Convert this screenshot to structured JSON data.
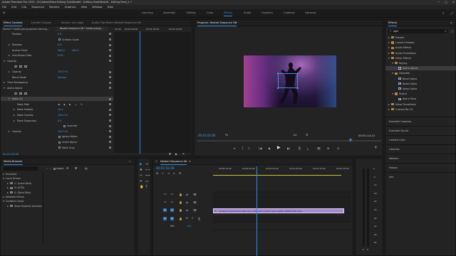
{
  "app": {
    "title": "Adobe Premiere Pro 2022 - D:\\Video\\Video Editing Tuts\\Reddit - Editing Feed\\Reddit - Editing Feed_1 *",
    "window_controls": [
      "−",
      "□",
      "✕"
    ]
  },
  "menu": [
    "File",
    "Edit",
    "Clip",
    "Sequence",
    "Markers",
    "Graphics",
    "View",
    "Window",
    "Help"
  ],
  "workspaces": {
    "items": [
      "Learning",
      "Assembly",
      "Editing",
      "Color",
      "Effects",
      "Audio",
      "Graphics",
      "Captions",
      "Libraries"
    ],
    "active": "Effects"
  },
  "effect_controls": {
    "tabs": [
      "Effect Controls",
      "Lumetri Scopes",
      "Source: (no clips)",
      "Audio Clip Mixer: Nested Sequence 06"
    ],
    "source_label": "Source * model-young-woman-dancing...",
    "sequence_label": "Nested Sequence 06 * model-young...",
    "ruler_times": [
      "00:00",
      "00:01:00:00",
      "00:01:05:00",
      "00:01:10:00"
    ],
    "properties": [
      {
        "name": "Position",
        "v1": "0.0",
        "v2": "",
        "indent": 1,
        "expander": "none"
      },
      {
        "name": "Uniform Scale",
        "v1": "",
        "v2": "",
        "indent": 1,
        "expander": "checkbox"
      },
      {
        "name": "Rotation",
        "v1": "0.0",
        "v2": "",
        "indent": 1,
        "expander": "right"
      },
      {
        "name": "Anchor Point",
        "v1": "960.0",
        "v2": "540.0",
        "indent": 1,
        "expander": "none"
      },
      {
        "name": "Anti-flicker Filter",
        "v1": "0.00",
        "v2": "",
        "indent": 1,
        "expander": "right"
      },
      {
        "name": "Opacity",
        "v1": "",
        "v2": "",
        "indent": 0,
        "expander": "down"
      },
      {
        "name": "",
        "v1": "",
        "v2": "",
        "indent": 1,
        "expander": "masks"
      },
      {
        "name": "Opacity",
        "v1": "100.0 %",
        "v2": "",
        "indent": 1,
        "expander": "right"
      },
      {
        "name": "Blend Mode",
        "v1": "Normal",
        "v2": "",
        "indent": 1,
        "expander": "none"
      },
      {
        "name": "Time Remapping",
        "v1": "",
        "v2": "",
        "indent": 0,
        "expander": "right"
      },
      {
        "name": "Alpha Adjust",
        "v1": "",
        "v2": "",
        "indent": 0,
        "expander": "down"
      },
      {
        "name": "",
        "v1": "",
        "v2": "",
        "indent": 1,
        "expander": "masks"
      },
      {
        "name": "Mask (1)",
        "v1": "",
        "v2": "",
        "indent": 1,
        "expander": "down",
        "selected": true
      },
      {
        "name": "Mask Path",
        "v1": "",
        "v2": "",
        "indent": 2,
        "expander": "none"
      },
      {
        "name": "Mask Feather",
        "v1": "10.0",
        "v2": "",
        "indent": 2,
        "expander": "right"
      },
      {
        "name": "Mask Opacity",
        "v1": "100.0 %",
        "v2": "",
        "indent": 2,
        "expander": "right"
      },
      {
        "name": "Mask Expansion",
        "v1": "0.0",
        "v2": "",
        "indent": 2,
        "expander": "right"
      },
      {
        "name": "Inverted",
        "v1": "",
        "v2": "",
        "indent": 2,
        "expander": "checkbox"
      },
      {
        "name": "Opacity",
        "v1": "100.0 %",
        "v2": "",
        "indent": 1,
        "expander": "right"
      },
      {
        "name": "Ignore Alpha",
        "v1": "",
        "v2": "",
        "indent": 1,
        "expander": "checkbox"
      },
      {
        "name": "Invert Alpha",
        "v1": "",
        "v2": "",
        "indent": 1,
        "expander": "checkbox"
      },
      {
        "name": "Mask Only",
        "v1": "",
        "v2": "",
        "indent": 1,
        "expander": "checkbox"
      }
    ],
    "timecode": "00:01:02:06"
  },
  "program": {
    "tab": "Program: Nested Sequence 06",
    "timecode": "00:01:02:06",
    "fit": "Fit",
    "quality": "1/4",
    "duration": "00:01:14:13",
    "controls": [
      "▾",
      "{",
      "}",
      "|◀",
      "◀",
      "▶",
      "▶|",
      "⎘",
      "⤓",
      "📷",
      "⊞",
      "⊡",
      "+"
    ]
  },
  "effects_panel": {
    "tab": "Effects",
    "search_value": "alph",
    "tree": [
      {
        "label": "Presets",
        "indent": 0,
        "exp": "right",
        "kind": "folder"
      },
      {
        "label": "Lumetri Presets",
        "indent": 0,
        "exp": "right",
        "kind": "folder"
      },
      {
        "label": "Audio Effects",
        "indent": 0,
        "exp": "right",
        "kind": "folder"
      },
      {
        "label": "Audio Transitions",
        "indent": 0,
        "exp": "right",
        "kind": "folder"
      },
      {
        "label": "Video Effects",
        "indent": 0,
        "exp": "down",
        "kind": "folder"
      },
      {
        "label": "Keying",
        "indent": 1,
        "exp": "down",
        "kind": "folder"
      },
      {
        "label": "Alpha Adjust",
        "indent": 2,
        "exp": "none",
        "kind": "effect",
        "selected": true
      },
      {
        "label": "Obsolete",
        "indent": 1,
        "exp": "down",
        "kind": "folder"
      },
      {
        "label": "Bevel Alpha",
        "indent": 2,
        "exp": "none",
        "kind": "effect"
      },
      {
        "label": "Noise Alpha",
        "indent": 2,
        "exp": "none",
        "kind": "effect"
      },
      {
        "label": "Noise Alpha",
        "indent": 2,
        "exp": "none",
        "kind": "effect"
      },
      {
        "label": "Stylize",
        "indent": 1,
        "exp": "down",
        "kind": "folder"
      },
      {
        "label": "Alpha Glow",
        "indent": 2,
        "exp": "none",
        "kind": "effect"
      },
      {
        "label": "Video Transitions",
        "indent": 0,
        "exp": "right",
        "kind": "folder"
      },
      {
        "label": "Custom Bin 01",
        "indent": 0,
        "exp": "right",
        "kind": "folder"
      }
    ],
    "sections": [
      "Essential Graphics",
      "Essential Sound",
      "Lumetri Color",
      "Libraries",
      "Markers",
      "History",
      "Info"
    ]
  },
  "media_browser": {
    "tab": "Media Browser",
    "ingest_label": "Ingest",
    "groups": [
      {
        "label": "Favorites",
        "indent": 0,
        "exp": "right"
      },
      {
        "label": "Local Drives",
        "indent": 0,
        "exp": "down"
      },
      {
        "label": "C: (Local Disk)",
        "indent": 1,
        "exp": "right"
      },
      {
        "label": "D: (STB)",
        "indent": 1,
        "exp": "right"
      },
      {
        "label": "E: (Data Disk)",
        "indent": 1,
        "exp": "right"
      },
      {
        "label": "Network Drives",
        "indent": 0,
        "exp": "right"
      },
      {
        "label": "Creative Cloud",
        "indent": 0,
        "exp": "down"
      },
      {
        "label": "Team Projects Versions",
        "indent": 1,
        "exp": "right"
      }
    ]
  },
  "timeline": {
    "tab": "Nested Sequence 06",
    "timecode": "00:01:02:06",
    "ruler": [
      "00:00:15:00",
      "00:00:30:00",
      "00:00:45:00",
      "00:01:00:00",
      "00:01:15:00",
      "00:01:30:00"
    ],
    "playhead_fraction": 0.316,
    "tracks": [
      {
        "name": "V3",
        "kind": "video",
        "targeted": false
      },
      {
        "name": "V2",
        "kind": "video",
        "targeted": false
      },
      {
        "name": "V1",
        "kind": "video",
        "targeted": true
      },
      {
        "name": "A1",
        "kind": "audio",
        "targeted": true
      },
      {
        "name": "Mix",
        "kind": "mix",
        "value": "0.0"
      }
    ],
    "clip": {
      "label": "model-young-woman-dancing-under-the-colorful-neon-lights_3840x2160.mp4",
      "fx": "fx",
      "track": "V1",
      "start_fraction": 0.0,
      "end_fraction": 0.95,
      "color": "#a38ad0"
    },
    "work_area_color": "#c4c437"
  },
  "audio_meter": {
    "scale": [
      "0",
      "-6",
      "-12",
      "-18",
      "-24",
      "-30",
      "-36",
      "-42",
      "-48",
      "-54"
    ],
    "channels": [
      "S",
      "S"
    ]
  },
  "tools": [
    "▶",
    "⇥",
    "✥",
    "⟷",
    "✂",
    "⟺",
    "✒",
    "▭",
    "✋",
    "T"
  ],
  "colors": {
    "accent": "#2d8ceb",
    "timecode": "#3f9ef5",
    "clip": "#a38ad0"
  }
}
